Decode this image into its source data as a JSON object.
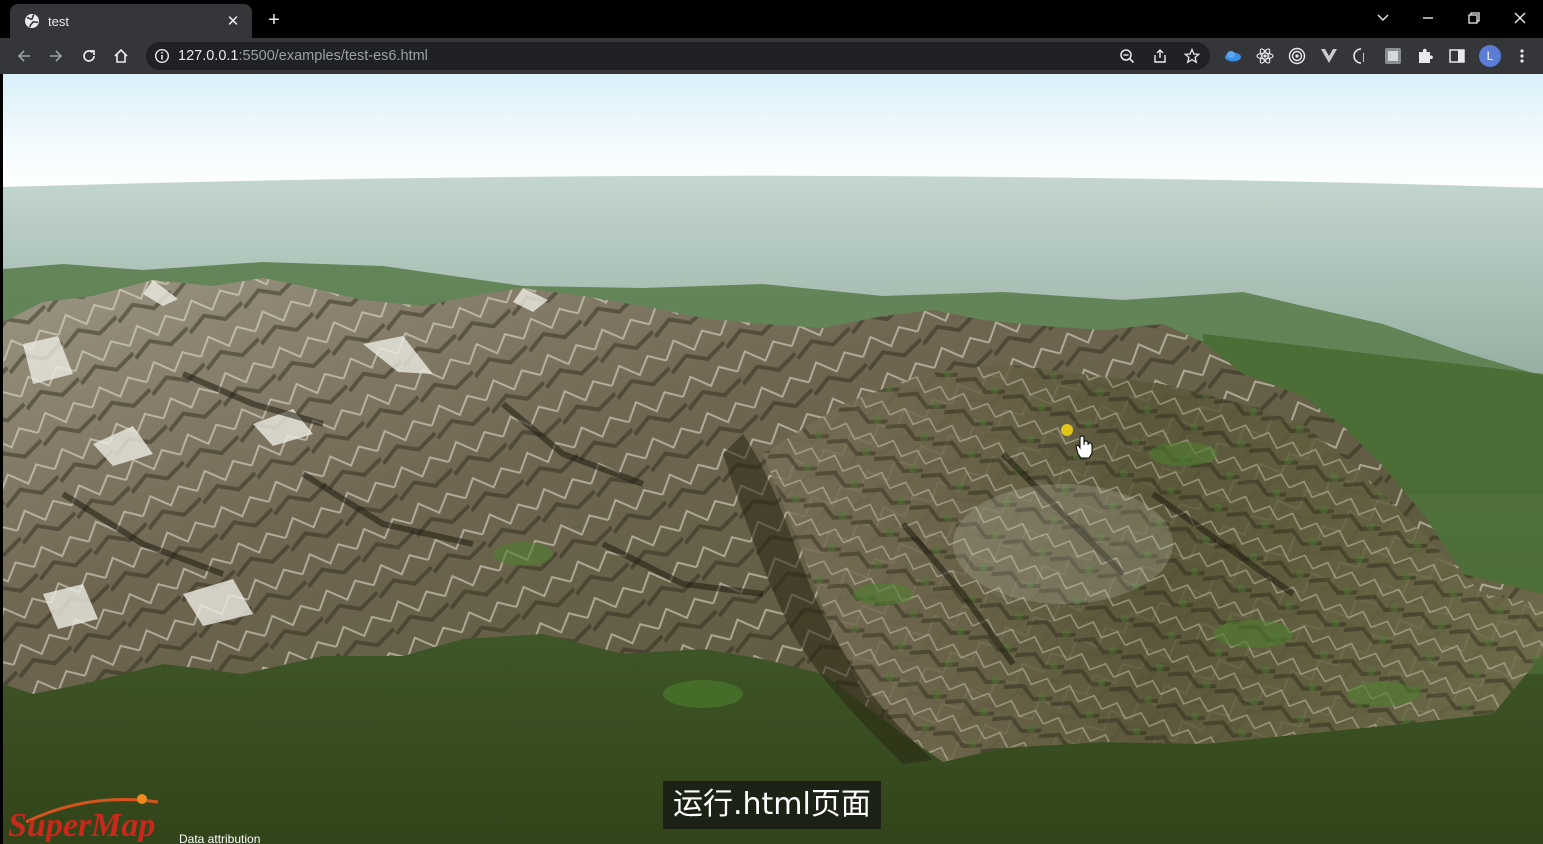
{
  "tab": {
    "title": "test",
    "favicon": "globe-icon",
    "close_icon": "close-icon"
  },
  "toolbar": {
    "url_host": "127.0.0.1",
    "url_rest": ":5500/examples/test-es6.html"
  },
  "extensions": [
    "cloud-extension-icon",
    "react-extension-icon",
    "target-extension-icon",
    "vue-extension-icon",
    "code-extension-icon",
    "translate-extension-icon",
    "puzzle-icon",
    "sidebar-icon"
  ],
  "profile": {
    "initial": "L",
    "color": "#5b7bd5"
  },
  "map": {
    "logo": "SuperMap",
    "attribution": "Data attribution"
  },
  "subtitle": "运行.html页面",
  "colors": {
    "tab_strip": "#000000",
    "toolbar": "#35363a",
    "omnibox": "#202124",
    "ground": "#3a4a1e"
  }
}
